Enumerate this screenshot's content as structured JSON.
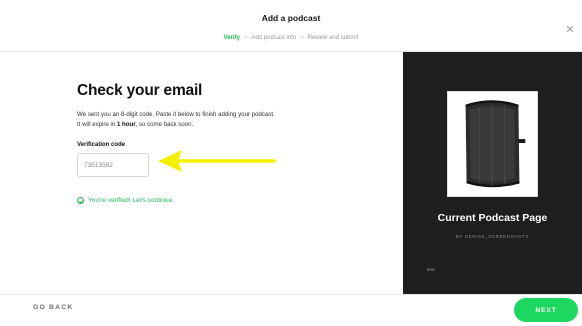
{
  "header": {
    "title": "Add a podcast",
    "close_icon": "close-icon",
    "steps": [
      {
        "label": "Verify"
      },
      {
        "label": "Add podcast info"
      },
      {
        "label": "Review and submit"
      }
    ],
    "step_separator": ">"
  },
  "main": {
    "heading": "Check your email",
    "desc_line1": "We sent you an 8-digit code. Paste it below to finish adding your podcast.",
    "desc_line2_pre": "It will expire in ",
    "desc_line2_bold": "1 hour",
    "desc_line2_post": ", so come back soon.",
    "code_label": "Verification code",
    "code_value": "73513582",
    "verified_text": "You're verified! Let's continue."
  },
  "preview": {
    "title": "Current Podcast Page",
    "author": "BY DENISE_SCREENSHOTS",
    "description": "test"
  },
  "footer": {
    "back_label": "GO BACK",
    "next_label": "NEXT"
  },
  "colors": {
    "accent": "#1db954",
    "next_button": "#1ed760",
    "arrow": "#f4f000",
    "preview_bg": "#1e1e1e"
  }
}
